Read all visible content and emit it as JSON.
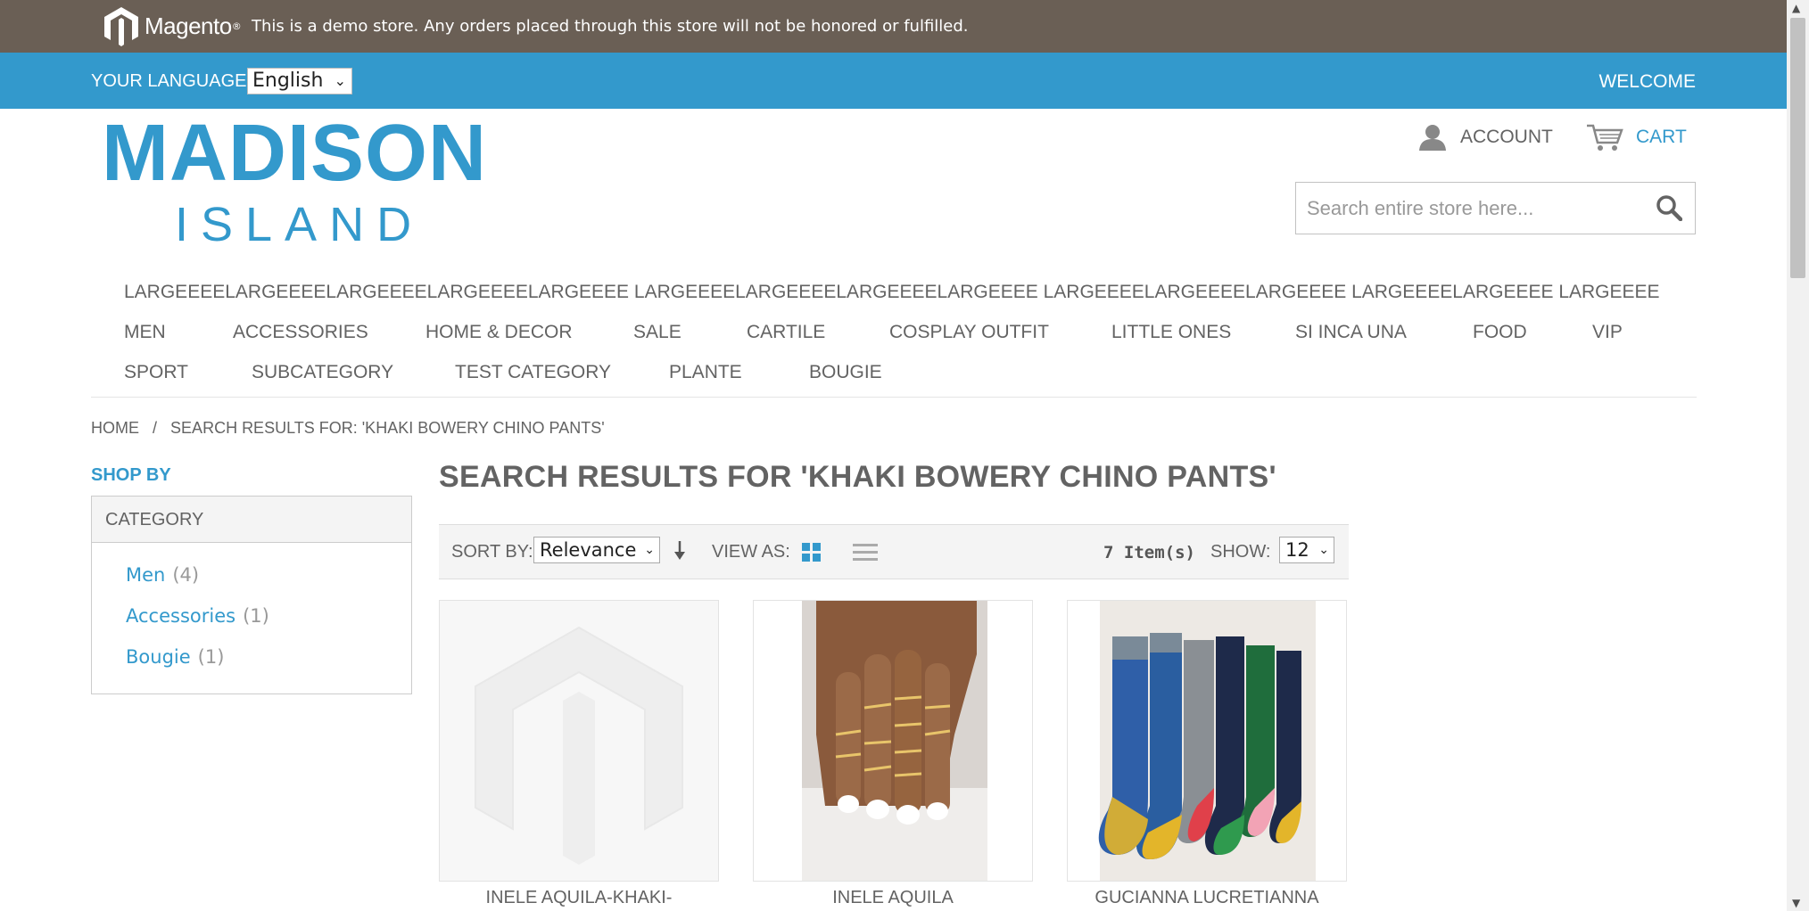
{
  "demo_notice": {
    "brand": "Magento",
    "text": "This is a demo store. Any orders placed through this store will not be honored or fulfilled."
  },
  "language_bar": {
    "label": "YOUR LANGUAGE:",
    "selected": "English",
    "welcome": "WELCOME"
  },
  "header": {
    "logo_main": "MADISON",
    "logo_sub": "ISLAND",
    "account": "ACCOUNT",
    "cart": "CART",
    "search_placeholder": "Search entire store here..."
  },
  "nav": {
    "row1": [
      "LARGEEEELARGEEEELARGEEEELARGEEEELARGEEEE LARGEEEELARGEEEELARGEEEELARGEEEE LARGEEEELARGEEEELARGEEEE LARGEEEELARGEEEE LARGEEEE"
    ],
    "row2": [
      "MEN",
      "ACCESSORIES",
      "HOME & DECOR",
      "SALE",
      "CARTILE",
      "COSPLAY OUTFIT",
      "LITTLE ONES",
      "SI INCA UNA",
      "FOOD",
      "VIP"
    ],
    "row3": [
      "SPORT",
      "SUBCATEGORY",
      "TEST CATEGORY",
      "PLANTE",
      "BOUGIE"
    ]
  },
  "breadcrumb": {
    "home": "HOME",
    "separator": "/",
    "current": "SEARCH RESULTS FOR: 'KHAKI BOWERY CHINO PANTS'"
  },
  "sidebar": {
    "shop_by": "SHOP BY",
    "filter_title": "CATEGORY",
    "items": [
      {
        "label": "Men",
        "count": "(4)"
      },
      {
        "label": "Accessories",
        "count": "(1)"
      },
      {
        "label": "Bougie",
        "count": "(1)"
      }
    ]
  },
  "main": {
    "title": "SEARCH RESULTS FOR 'KHAKI BOWERY CHINO PANTS'"
  },
  "toolbar": {
    "sort_label": "SORT BY:",
    "sort_value": "Relevance",
    "view_label": "VIEW AS:",
    "item_count": "7 Item(s)",
    "show_label": "SHOW:",
    "show_value": "12"
  },
  "products": [
    {
      "name": "INELE AQUILA-KHAKI-"
    },
    {
      "name": "INELE AQUILA"
    },
    {
      "name": "GUCIANNA LUCRETIANNA"
    }
  ],
  "colors": {
    "accent": "#3399cc",
    "demo_bar": "#6a5f55",
    "text": "#636363"
  }
}
